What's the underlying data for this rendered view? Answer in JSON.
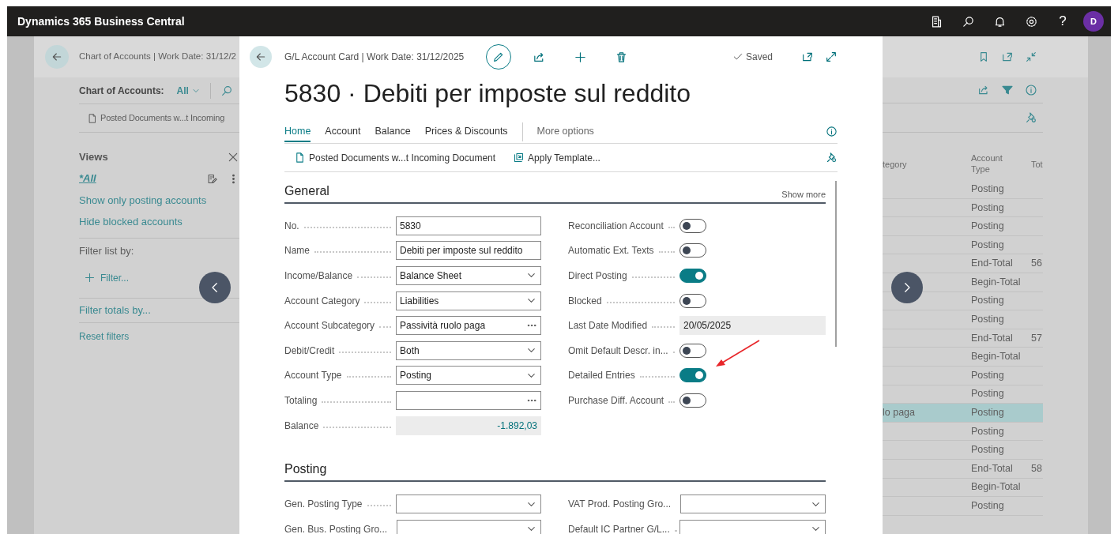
{
  "app_bar": {
    "title": "Dynamics 365 Business Central",
    "help": "?",
    "avatar": "D"
  },
  "background_page": {
    "breadcrumb": "Chart of Accounts | Work Date: 31/12/2",
    "list_label": "Chart of Accounts:",
    "view_filter": "All",
    "action": "Posted Documents w...t Incoming",
    "views_title": "Views",
    "views": [
      {
        "label": "*All",
        "selected": true
      },
      {
        "label": "Show only posting accounts",
        "selected": false
      },
      {
        "label": "Hide blocked accounts",
        "selected": false
      }
    ],
    "filter_list_label": "Filter list by:",
    "add_filter": "Filter...",
    "filter_totals": "Filter totals by...",
    "reset_filters": "Reset filters",
    "table": {
      "columns": [
        "tegory",
        "Account Type",
        "Tot"
      ],
      "rows": [
        {
          "cells": [
            "",
            "Posting",
            ""
          ],
          "selected": false
        },
        {
          "cells": [
            "",
            "Posting",
            ""
          ],
          "selected": false
        },
        {
          "cells": [
            "",
            "Posting",
            ""
          ],
          "selected": false
        },
        {
          "cells": [
            "",
            "Posting",
            ""
          ],
          "selected": false
        },
        {
          "cells": [
            "",
            "End-Total",
            "56"
          ],
          "selected": false
        },
        {
          "cells": [
            "",
            "Begin-Total",
            ""
          ],
          "selected": false
        },
        {
          "cells": [
            "",
            "Posting",
            ""
          ],
          "selected": false
        },
        {
          "cells": [
            "",
            "Posting",
            ""
          ],
          "selected": false
        },
        {
          "cells": [
            "",
            "End-Total",
            "57"
          ],
          "selected": false
        },
        {
          "cells": [
            "",
            "Begin-Total",
            ""
          ],
          "selected": false
        },
        {
          "cells": [
            "",
            "Posting",
            ""
          ],
          "selected": false
        },
        {
          "cells": [
            "",
            "Posting",
            ""
          ],
          "selected": false
        },
        {
          "cells": [
            "lo paga",
            "Posting",
            ""
          ],
          "selected": true
        },
        {
          "cells": [
            "",
            "Posting",
            ""
          ],
          "selected": false
        },
        {
          "cells": [
            "",
            "Posting",
            ""
          ],
          "selected": false
        },
        {
          "cells": [
            "",
            "End-Total",
            "58"
          ],
          "selected": false
        },
        {
          "cells": [
            "",
            "Begin-Total",
            ""
          ],
          "selected": false
        },
        {
          "cells": [
            "",
            "Posting",
            ""
          ],
          "selected": false
        }
      ]
    }
  },
  "dialog": {
    "breadcrumb": "G/L Account Card | Work Date: 31/12/2025",
    "save_status": "Saved",
    "title": "5830 · Debiti per imposte sul reddito",
    "tabs": [
      {
        "label": "Home",
        "selected": true
      },
      {
        "label": "Account",
        "selected": false
      },
      {
        "label": "Balance",
        "selected": false
      },
      {
        "label": "Prices & Discounts",
        "selected": false
      }
    ],
    "more_options": "More options",
    "actions": [
      {
        "label": "Posted Documents w...t Incoming Document",
        "kind": "document"
      },
      {
        "label": "Apply Template...",
        "kind": "template"
      }
    ],
    "sections": [
      {
        "title": "General",
        "show_more": "Show more",
        "left": [
          {
            "label": "No.",
            "kind": "text",
            "value": "5830"
          },
          {
            "label": "Name",
            "kind": "text",
            "value": "Debiti per imposte sul reddito"
          },
          {
            "label": "Income/Balance",
            "kind": "select",
            "value": "Balance Sheet"
          },
          {
            "label": "Account Category",
            "kind": "select",
            "value": "Liabilities"
          },
          {
            "label": "Account Subcategory",
            "kind": "lookup",
            "value": "Passività ruolo paga"
          },
          {
            "label": "Debit/Credit",
            "kind": "select",
            "value": "Both"
          },
          {
            "label": "Account Type",
            "kind": "select",
            "value": "Posting"
          },
          {
            "label": "Totaling",
            "kind": "lookup"
          },
          {
            "label": "Balance",
            "kind": "amount",
            "value": "-1.892,03"
          }
        ],
        "right": [
          {
            "label": "Reconciliation Account",
            "kind": "toggle",
            "on": false
          },
          {
            "label": "Automatic Ext. Texts",
            "kind": "toggle",
            "on": false
          },
          {
            "label": "Direct Posting",
            "kind": "toggle",
            "on": true
          },
          {
            "label": "Blocked",
            "kind": "toggle",
            "on": false
          },
          {
            "label": "Last Date Modified",
            "kind": "readonly",
            "value": "20/05/2025"
          },
          {
            "label": "Omit Default Descr. in...",
            "kind": "toggle",
            "on": false
          },
          {
            "label": "Detailed Entries",
            "kind": "toggle",
            "on": true
          },
          {
            "label": "Purchase Diff. Account",
            "kind": "toggle",
            "on": false
          }
        ]
      },
      {
        "title": "Posting",
        "left": [
          {
            "label": "Gen. Posting Type",
            "kind": "select"
          },
          {
            "label": "Gen. Bus. Posting Gro...",
            "kind": "select"
          }
        ],
        "right": [
          {
            "label": "VAT Prod. Posting Gro...",
            "kind": "select"
          },
          {
            "label": "Default IC Partner G/L...",
            "kind": "select"
          }
        ]
      }
    ]
  }
}
